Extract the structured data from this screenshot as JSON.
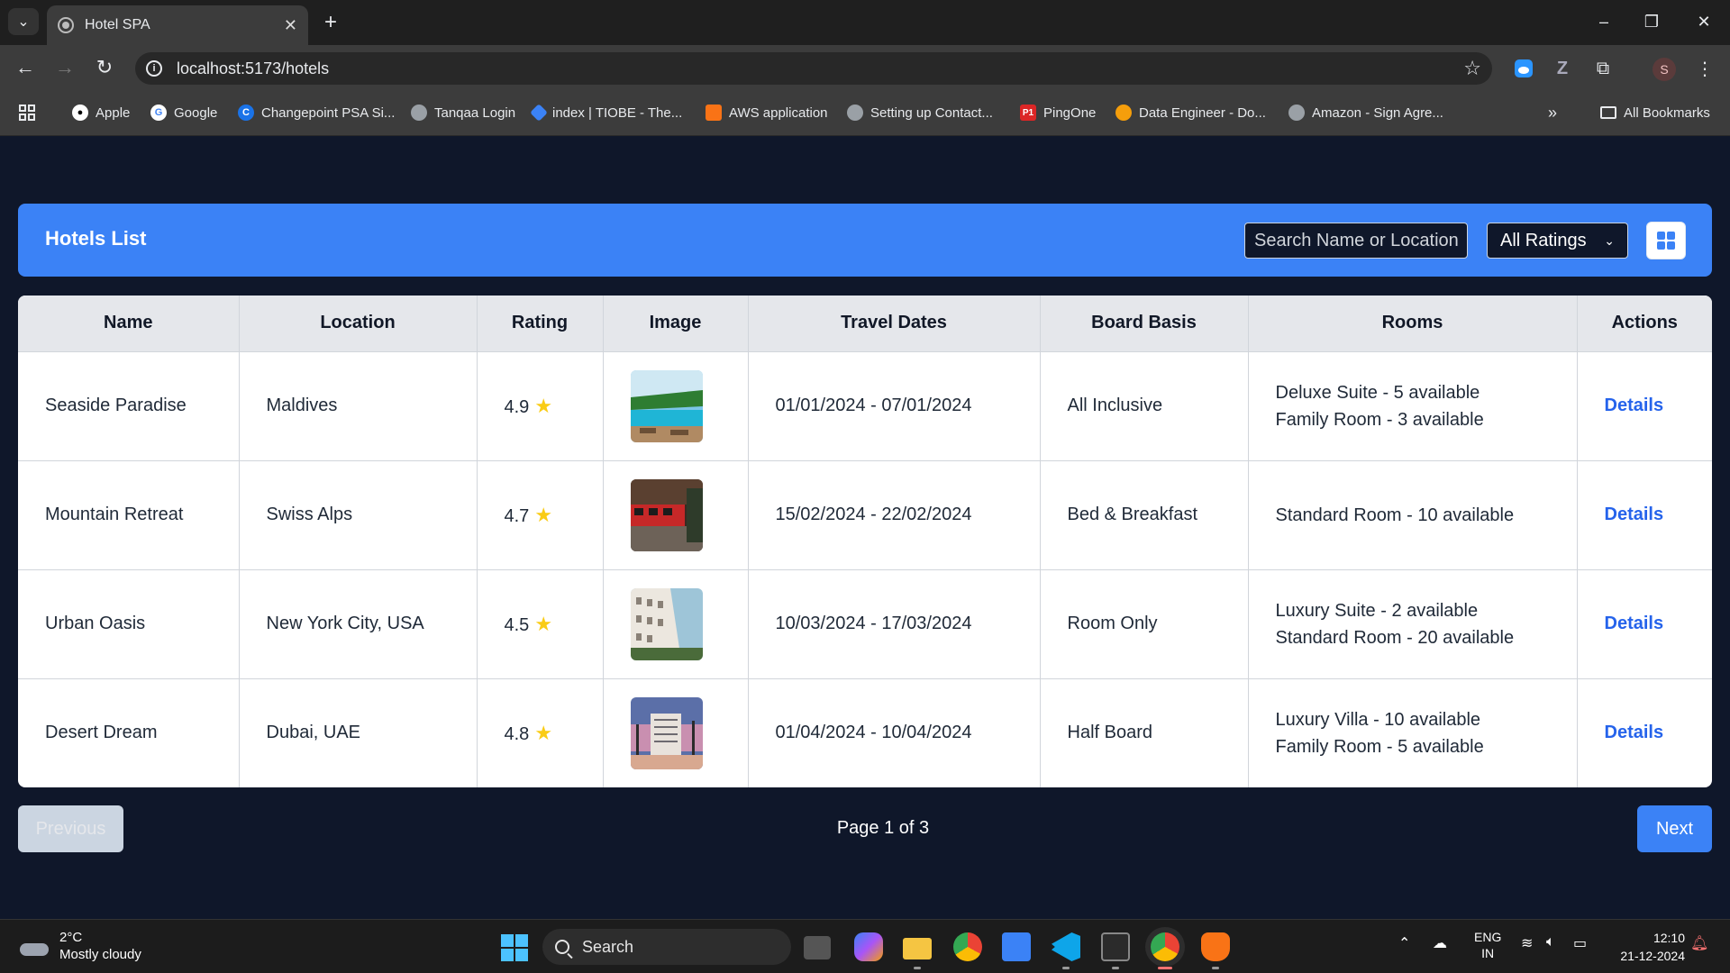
{
  "browser": {
    "tab_title": "Hotel SPA",
    "tab_close": "✕",
    "new_tab": "+",
    "url": "localhost:5173/hotels",
    "profile_initial": "S",
    "bookmarks": [
      {
        "label": "Apple",
        "icon": "apple-icon",
        "color": "#ffffff"
      },
      {
        "label": "Google",
        "icon": "google-icon",
        "color": "#4285f4"
      },
      {
        "label": "Changepoint PSA Si...",
        "icon": "changepoint-icon",
        "color": "#1a73e8"
      },
      {
        "label": "Tanqaa Login",
        "icon": "globe-icon",
        "color": "#9aa0a6"
      },
      {
        "label": "index | TIOBE - The...",
        "icon": "tiobe-icon",
        "color": "#3b82f6"
      },
      {
        "label": "AWS application",
        "icon": "aws-icon",
        "color": "#f97316"
      },
      {
        "label": "Setting up Contact...",
        "icon": "globe-icon",
        "color": "#9aa0a6"
      },
      {
        "label": "PingOne",
        "icon": "pingone-icon",
        "color": "#dc2626"
      },
      {
        "label": "Data Engineer - Do...",
        "icon": "data-engineer-icon",
        "color": "#f59e0b"
      },
      {
        "label": "Amazon - Sign Agre...",
        "icon": "globe-icon",
        "color": "#9aa0a6"
      }
    ],
    "all_bookmarks": "All Bookmarks"
  },
  "page": {
    "title": "Hotels List",
    "search_placeholder": "Search Name or Location",
    "rating_filter": "All Ratings",
    "columns": [
      "Name",
      "Location",
      "Rating",
      "Image",
      "Travel Dates",
      "Board Basis",
      "Rooms",
      "Actions"
    ],
    "hotels": [
      {
        "name": "Seaside Paradise",
        "location": "Maldives",
        "rating": "4.9",
        "image": "pool-resort-photo",
        "dates": "01/01/2024 - 07/01/2024",
        "board": "All Inclusive",
        "rooms": [
          "Deluxe Suite - 5 available",
          "Family Room - 3 available"
        ],
        "action": "Details"
      },
      {
        "name": "Mountain Retreat",
        "location": "Swiss Alps",
        "rating": "4.7",
        "image": "street-tram-photo",
        "dates": "15/02/2024 - 22/02/2024",
        "board": "Bed & Breakfast",
        "rooms": [
          "Standard Room - 10 available"
        ],
        "action": "Details"
      },
      {
        "name": "Urban Oasis",
        "location": "New York City, USA",
        "rating": "4.5",
        "image": "white-building-photo",
        "dates": "10/03/2024 - 17/03/2024",
        "board": "Room Only",
        "rooms": [
          "Luxury Suite - 2 available",
          "Standard Room - 20 available"
        ],
        "action": "Details"
      },
      {
        "name": "Desert Dream",
        "location": "Dubai, UAE",
        "rating": "4.8",
        "image": "sunset-hotel-photo",
        "dates": "01/04/2024 - 10/04/2024",
        "board": "Half Board",
        "rooms": [
          "Luxury Villa - 10 available",
          "Family Room - 5 available"
        ],
        "action": "Details"
      }
    ],
    "pagination": {
      "previous": "Previous",
      "status": "Page 1 of 3",
      "next": "Next"
    }
  },
  "taskbar": {
    "temperature": "2°C",
    "weather": "Mostly cloudy",
    "search": "Search",
    "lang": "ENG",
    "region": "IN",
    "time": "12:10",
    "date": "21-12-2024"
  },
  "colors": {
    "accent": "#3b82f6",
    "link": "#2563eb",
    "star": "#facc15",
    "page_bg": "#0f172a"
  }
}
